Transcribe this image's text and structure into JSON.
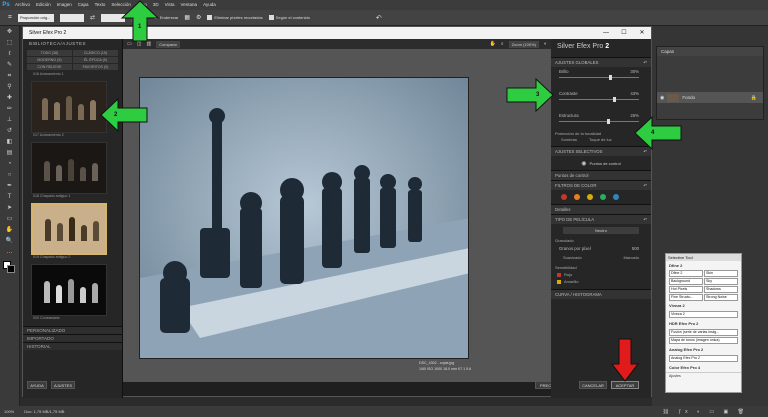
{
  "photoshop": {
    "logo": "Ps",
    "menu": [
      "Archivo",
      "Edición",
      "Imagen",
      "Capa",
      "Texto",
      "Selección",
      "Filtro",
      "3D",
      "Vista",
      "Ventana",
      "Ayuda"
    ],
    "options": {
      "style_select": "Proporción orig...",
      "enderezar": "Enderezar",
      "eliminar": "Eliminar píxeles recortados",
      "segun": "Según el contenido"
    },
    "status": {
      "zoom": "100%",
      "doc": "Doc: 1,75 MB/1,75 MB"
    },
    "layers_tab": "Capas",
    "layer_name": "Fondo"
  },
  "sefx": {
    "title": "Silver Efex Pro 2",
    "window_controls": [
      "—",
      "☐",
      "✕"
    ],
    "left_tab": "BIBLIOTECA/AJUSTES",
    "categories": [
      "TODO (38)",
      "CLÁSICO (15)",
      "MODERNO (9)",
      "ÉL ÉPOCA (9)",
      "CON RELIEVE",
      "FAVORITOS (0)"
    ],
    "thumbs": [
      {
        "caption": "016 Aclaramiento 1",
        "selected": false
      },
      {
        "caption": "017 Aclaramiento 2",
        "selected": false
      },
      {
        "caption": "018 Chapado antiguo 1",
        "selected": false
      },
      {
        "caption": "019 Chapado antiguo 2",
        "selected": true
      },
      {
        "caption": "020 Contrastado",
        "selected": false
      }
    ],
    "left_sections": [
      "PERSONALIZADO",
      "IMPORTADO",
      "HISTORIAL"
    ],
    "left_buttons": [
      "AYUDA",
      "AJUSTES"
    ],
    "compare_label": "Comparar",
    "zoom_label": "Zoom (100%)",
    "photo_caption": "DSC_4302 - copia.jpg",
    "photo_meta": "1/60 ISO 1000 18.0 mm f/7.1 5.6",
    "right_title": "Silver Efex Pro",
    "right_title_num": "2",
    "sections": {
      "global": "AJUSTES GLOBALES",
      "brillo": "Brillo",
      "brillo_val": "30%",
      "contraste": "Contraste",
      "contraste_val": "43%",
      "estructura": "Estructura",
      "estructura_val": "26%",
      "proteccion": "Protección de la tonalidad",
      "sombras": "Sombras",
      "luces": "Toque de luz",
      "selectivos": "AJUSTES SELECTIVOS",
      "puntos": "Puntos de control",
      "puntos_ctrl": "Puntos de control",
      "filtros": "FILTROS DE COLOR",
      "detalles": "Detalles",
      "tipo": "TIPO DE PELÍCULA",
      "neutro": "Neutro",
      "granulado": "Granulado",
      "grano": "Granos por píxel",
      "grano_val": "500",
      "suavizado": "Suavizado",
      "marcado": "Marcado",
      "sensibilidad": "Sensibilidad",
      "rojo": "Rojo",
      "amarillo": "Amarillo",
      "curva": "CURVA / HISTOGRAMA"
    },
    "bottom_buttons": {
      "reset": "PRECEL",
      "cancel": "CANCELAR",
      "ok": "ACEPTAR"
    },
    "filter_colors": [
      "#c0392b",
      "#e67e22",
      "#d4ac0d",
      "#27ae60",
      "#2e86c1"
    ]
  },
  "selective_tool": {
    "title": "Selective Tool",
    "groups": [
      {
        "name": "Dfine 2",
        "items": [
          "Dfine 2",
          "Skin",
          "Background",
          "Sky",
          "Hot Pixels",
          "Shadows",
          "Fine Structu...",
          "Strong Noise"
        ]
      },
      {
        "name": "Viveza 2",
        "items": [
          "Viveza 2"
        ]
      },
      {
        "name": "HDR Efex Pro 2",
        "items": [
          "Fusión (serie de varias imág...",
          "Mapa de tonos (imagen única)"
        ]
      },
      {
        "name": "Analog Efex Pro 2",
        "items": [
          "Analog Efex Pro 2"
        ]
      },
      {
        "name": "Color Efex Pro 4",
        "items": []
      }
    ],
    "footer": "Ajustes"
  },
  "annotations": [
    "1",
    "2",
    "3",
    "4"
  ],
  "colors": {
    "arrow_green": "#2ecc40",
    "arrow_red": "#e11b1b",
    "accent_gold": "#d7b46c"
  }
}
